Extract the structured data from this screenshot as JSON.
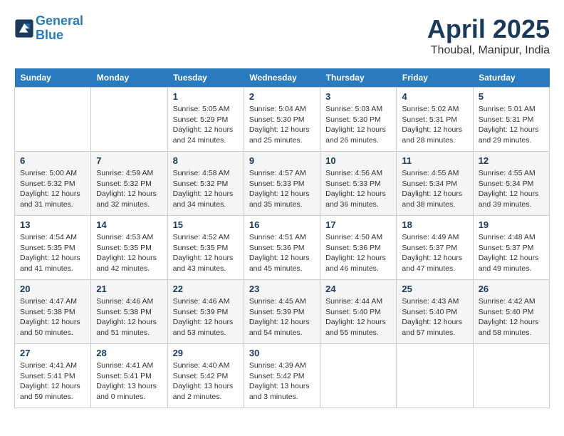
{
  "header": {
    "logo_line1": "General",
    "logo_line2": "Blue",
    "month": "April 2025",
    "location": "Thoubal, Manipur, India"
  },
  "days_of_week": [
    "Sunday",
    "Monday",
    "Tuesday",
    "Wednesday",
    "Thursday",
    "Friday",
    "Saturday"
  ],
  "weeks": [
    [
      {
        "day": "",
        "info": ""
      },
      {
        "day": "",
        "info": ""
      },
      {
        "day": "1",
        "info": "Sunrise: 5:05 AM\nSunset: 5:29 PM\nDaylight: 12 hours and 24 minutes."
      },
      {
        "day": "2",
        "info": "Sunrise: 5:04 AM\nSunset: 5:30 PM\nDaylight: 12 hours and 25 minutes."
      },
      {
        "day": "3",
        "info": "Sunrise: 5:03 AM\nSunset: 5:30 PM\nDaylight: 12 hours and 26 minutes."
      },
      {
        "day": "4",
        "info": "Sunrise: 5:02 AM\nSunset: 5:31 PM\nDaylight: 12 hours and 28 minutes."
      },
      {
        "day": "5",
        "info": "Sunrise: 5:01 AM\nSunset: 5:31 PM\nDaylight: 12 hours and 29 minutes."
      }
    ],
    [
      {
        "day": "6",
        "info": "Sunrise: 5:00 AM\nSunset: 5:32 PM\nDaylight: 12 hours and 31 minutes."
      },
      {
        "day": "7",
        "info": "Sunrise: 4:59 AM\nSunset: 5:32 PM\nDaylight: 12 hours and 32 minutes."
      },
      {
        "day": "8",
        "info": "Sunrise: 4:58 AM\nSunset: 5:32 PM\nDaylight: 12 hours and 34 minutes."
      },
      {
        "day": "9",
        "info": "Sunrise: 4:57 AM\nSunset: 5:33 PM\nDaylight: 12 hours and 35 minutes."
      },
      {
        "day": "10",
        "info": "Sunrise: 4:56 AM\nSunset: 5:33 PM\nDaylight: 12 hours and 36 minutes."
      },
      {
        "day": "11",
        "info": "Sunrise: 4:55 AM\nSunset: 5:34 PM\nDaylight: 12 hours and 38 minutes."
      },
      {
        "day": "12",
        "info": "Sunrise: 4:55 AM\nSunset: 5:34 PM\nDaylight: 12 hours and 39 minutes."
      }
    ],
    [
      {
        "day": "13",
        "info": "Sunrise: 4:54 AM\nSunset: 5:35 PM\nDaylight: 12 hours and 41 minutes."
      },
      {
        "day": "14",
        "info": "Sunrise: 4:53 AM\nSunset: 5:35 PM\nDaylight: 12 hours and 42 minutes."
      },
      {
        "day": "15",
        "info": "Sunrise: 4:52 AM\nSunset: 5:35 PM\nDaylight: 12 hours and 43 minutes."
      },
      {
        "day": "16",
        "info": "Sunrise: 4:51 AM\nSunset: 5:36 PM\nDaylight: 12 hours and 45 minutes."
      },
      {
        "day": "17",
        "info": "Sunrise: 4:50 AM\nSunset: 5:36 PM\nDaylight: 12 hours and 46 minutes."
      },
      {
        "day": "18",
        "info": "Sunrise: 4:49 AM\nSunset: 5:37 PM\nDaylight: 12 hours and 47 minutes."
      },
      {
        "day": "19",
        "info": "Sunrise: 4:48 AM\nSunset: 5:37 PM\nDaylight: 12 hours and 49 minutes."
      }
    ],
    [
      {
        "day": "20",
        "info": "Sunrise: 4:47 AM\nSunset: 5:38 PM\nDaylight: 12 hours and 50 minutes."
      },
      {
        "day": "21",
        "info": "Sunrise: 4:46 AM\nSunset: 5:38 PM\nDaylight: 12 hours and 51 minutes."
      },
      {
        "day": "22",
        "info": "Sunrise: 4:46 AM\nSunset: 5:39 PM\nDaylight: 12 hours and 53 minutes."
      },
      {
        "day": "23",
        "info": "Sunrise: 4:45 AM\nSunset: 5:39 PM\nDaylight: 12 hours and 54 minutes."
      },
      {
        "day": "24",
        "info": "Sunrise: 4:44 AM\nSunset: 5:40 PM\nDaylight: 12 hours and 55 minutes."
      },
      {
        "day": "25",
        "info": "Sunrise: 4:43 AM\nSunset: 5:40 PM\nDaylight: 12 hours and 57 minutes."
      },
      {
        "day": "26",
        "info": "Sunrise: 4:42 AM\nSunset: 5:40 PM\nDaylight: 12 hours and 58 minutes."
      }
    ],
    [
      {
        "day": "27",
        "info": "Sunrise: 4:41 AM\nSunset: 5:41 PM\nDaylight: 12 hours and 59 minutes."
      },
      {
        "day": "28",
        "info": "Sunrise: 4:41 AM\nSunset: 5:41 PM\nDaylight: 13 hours and 0 minutes."
      },
      {
        "day": "29",
        "info": "Sunrise: 4:40 AM\nSunset: 5:42 PM\nDaylight: 13 hours and 2 minutes."
      },
      {
        "day": "30",
        "info": "Sunrise: 4:39 AM\nSunset: 5:42 PM\nDaylight: 13 hours and 3 minutes."
      },
      {
        "day": "",
        "info": ""
      },
      {
        "day": "",
        "info": ""
      },
      {
        "day": "",
        "info": ""
      }
    ]
  ]
}
